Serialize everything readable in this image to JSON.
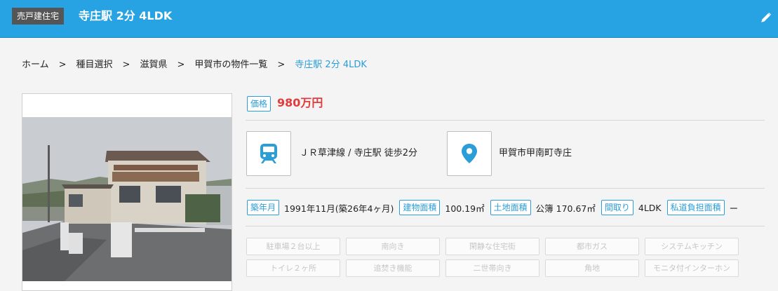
{
  "header": {
    "type_badge": "売戸建住宅",
    "title": "寺庄駅 2分 4LDK",
    "accent_color": "#27a3e3",
    "edit_icon": "pencil-icon"
  },
  "breadcrumb": {
    "items": [
      "ホーム",
      "種目選択",
      "滋賀県",
      "甲賀市の物件一覧"
    ],
    "current": "寺庄駅 2分 4LDK",
    "separator": ">"
  },
  "price": {
    "label": "価格",
    "value": "980万円",
    "color": "#e33b3b"
  },
  "access": {
    "icon": "train-icon",
    "text": "ＪＲ草津線 / 寺庄駅 徒歩2分"
  },
  "address": {
    "icon": "map-pin-icon",
    "text": "甲賀市甲南町寺庄"
  },
  "specs": [
    {
      "label": "築年月",
      "value": "1991年11月(築26年4ヶ月)"
    },
    {
      "label": "建物面積",
      "value": "100.19㎡"
    },
    {
      "label": "土地面積",
      "value": "公簿 170.67㎡"
    },
    {
      "label": "間取り",
      "value": "4LDK"
    },
    {
      "label": "私道負担面積",
      "value": "ー"
    }
  ],
  "features": [
    "駐車場２台以上",
    "南向き",
    "閑静な住宅街",
    "都市ガス",
    "システムキッチン",
    "トイレ２ヶ所",
    "追焚き機能",
    "二世帯向き",
    "角地",
    "モニタ付インターホン"
  ]
}
